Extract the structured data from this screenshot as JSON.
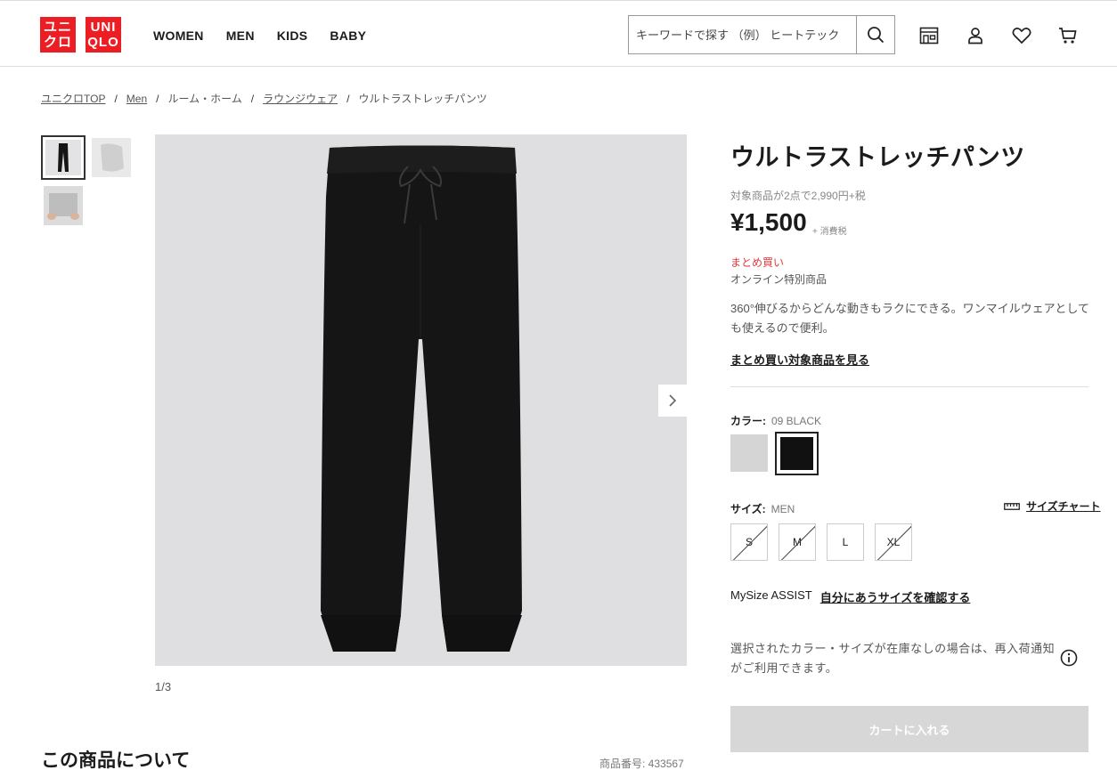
{
  "header": {
    "logo_top": "ユニクロ",
    "logo_bottom": "UNIQLO",
    "logo1_line1": "ユニ",
    "logo1_line2": "クロ",
    "logo2_line1": "UNI",
    "logo2_line2": "QLO",
    "nav": [
      "WOMEN",
      "MEN",
      "KIDS",
      "BABY"
    ],
    "search_placeholder": "キーワードで探す （例） ヒートテック",
    "icons": [
      "search-icon",
      "store-icon",
      "account-icon",
      "wishlist-heart-icon",
      "cart-icon"
    ]
  },
  "breadcrumb": [
    "ユニクロTOP",
    "Men",
    "ルーム・ホーム",
    "ラウンジウェア",
    "ウルトラストレッチパンツ"
  ],
  "gallery": {
    "pager": "1/3",
    "colors": {
      "thumb_bg": "#e3e3e6",
      "image_bg": "#dfdfe2",
      "pants": "#141414"
    }
  },
  "product": {
    "title": "ウルトラストレッチパンツ",
    "promo": "対象商品が2点で2,990円+税",
    "price": "¥1,500",
    "tax": "+ 消費税",
    "bundle_label": "まとめ買い",
    "online_label": "オンライン特別商品",
    "description": "360°伸びるからどんな動きもラクにできる。ワンマイルウェアとしても使えるので便利。",
    "bundle_link": "まとめ買い対象商品を見る",
    "color_label": "カラー:",
    "color_value": "09 BLACK",
    "swatches": [
      {
        "name": "GRAY",
        "hex": "#d5d5d5"
      },
      {
        "name": "BLACK",
        "hex": "#111111",
        "selected": true
      }
    ],
    "size_label": "サイズ:",
    "size_value": "MEN",
    "size_chart": "サイズチャート",
    "sizes": [
      {
        "label": "S",
        "available": false
      },
      {
        "label": "M",
        "available": false
      },
      {
        "label": "L",
        "available": true
      },
      {
        "label": "XL",
        "available": false
      }
    ],
    "mysize_label": "MySize ASSIST",
    "mysize_link": "自分にあうサイズを確認する",
    "restock_notice": "選択されたカラー・サイズが在庫なしの場合は、再入荷通知がご利用できます。",
    "cart_button": "カートに入れる",
    "accent_red": "#e0383e"
  },
  "about": {
    "heading": "この商品について",
    "product_no": "商品番号: 433567"
  }
}
